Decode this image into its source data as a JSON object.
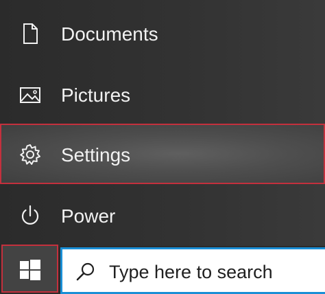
{
  "start_menu": {
    "items": [
      {
        "label": "Documents",
        "icon": "document-icon"
      },
      {
        "label": "Pictures",
        "icon": "pictures-icon"
      },
      {
        "label": "Settings",
        "icon": "gear-icon"
      },
      {
        "label": "Power",
        "icon": "power-icon"
      }
    ]
  },
  "taskbar": {
    "start_icon": "windows-logo-icon",
    "search": {
      "placeholder": "Type here to search",
      "icon": "search-icon"
    }
  },
  "colors": {
    "highlight_border": "#c4303d",
    "search_border": "#1a8fd6",
    "menu_text": "#f2f2f2"
  }
}
